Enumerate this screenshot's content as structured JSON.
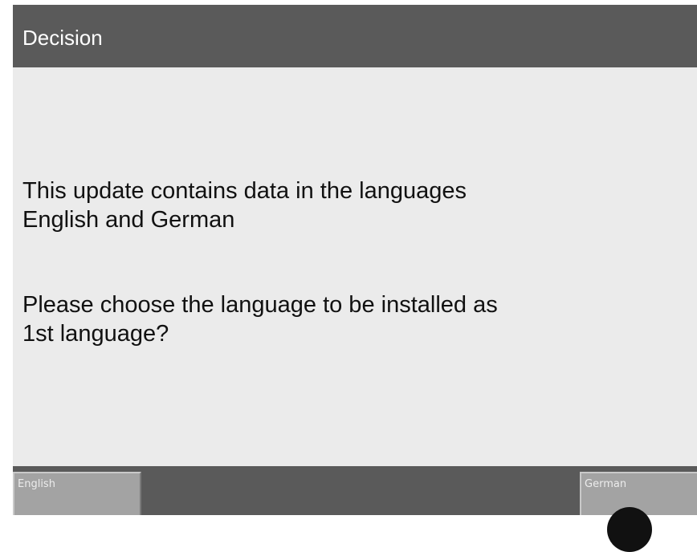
{
  "dialog": {
    "title": "Decision",
    "message_lines_1": [
      "This update contains data in the languages",
      "English and German"
    ],
    "message_lines_2": [
      "Please choose the language to be installed as",
      "1st language?"
    ]
  },
  "buttons": {
    "english_label": "English",
    "german_label": "German"
  },
  "colors": {
    "frame": "#5a5a5a",
    "content_background": "#ebebeb",
    "button": "#a3a3a3",
    "title_text": "#ffffff",
    "message_text": "#111111"
  }
}
